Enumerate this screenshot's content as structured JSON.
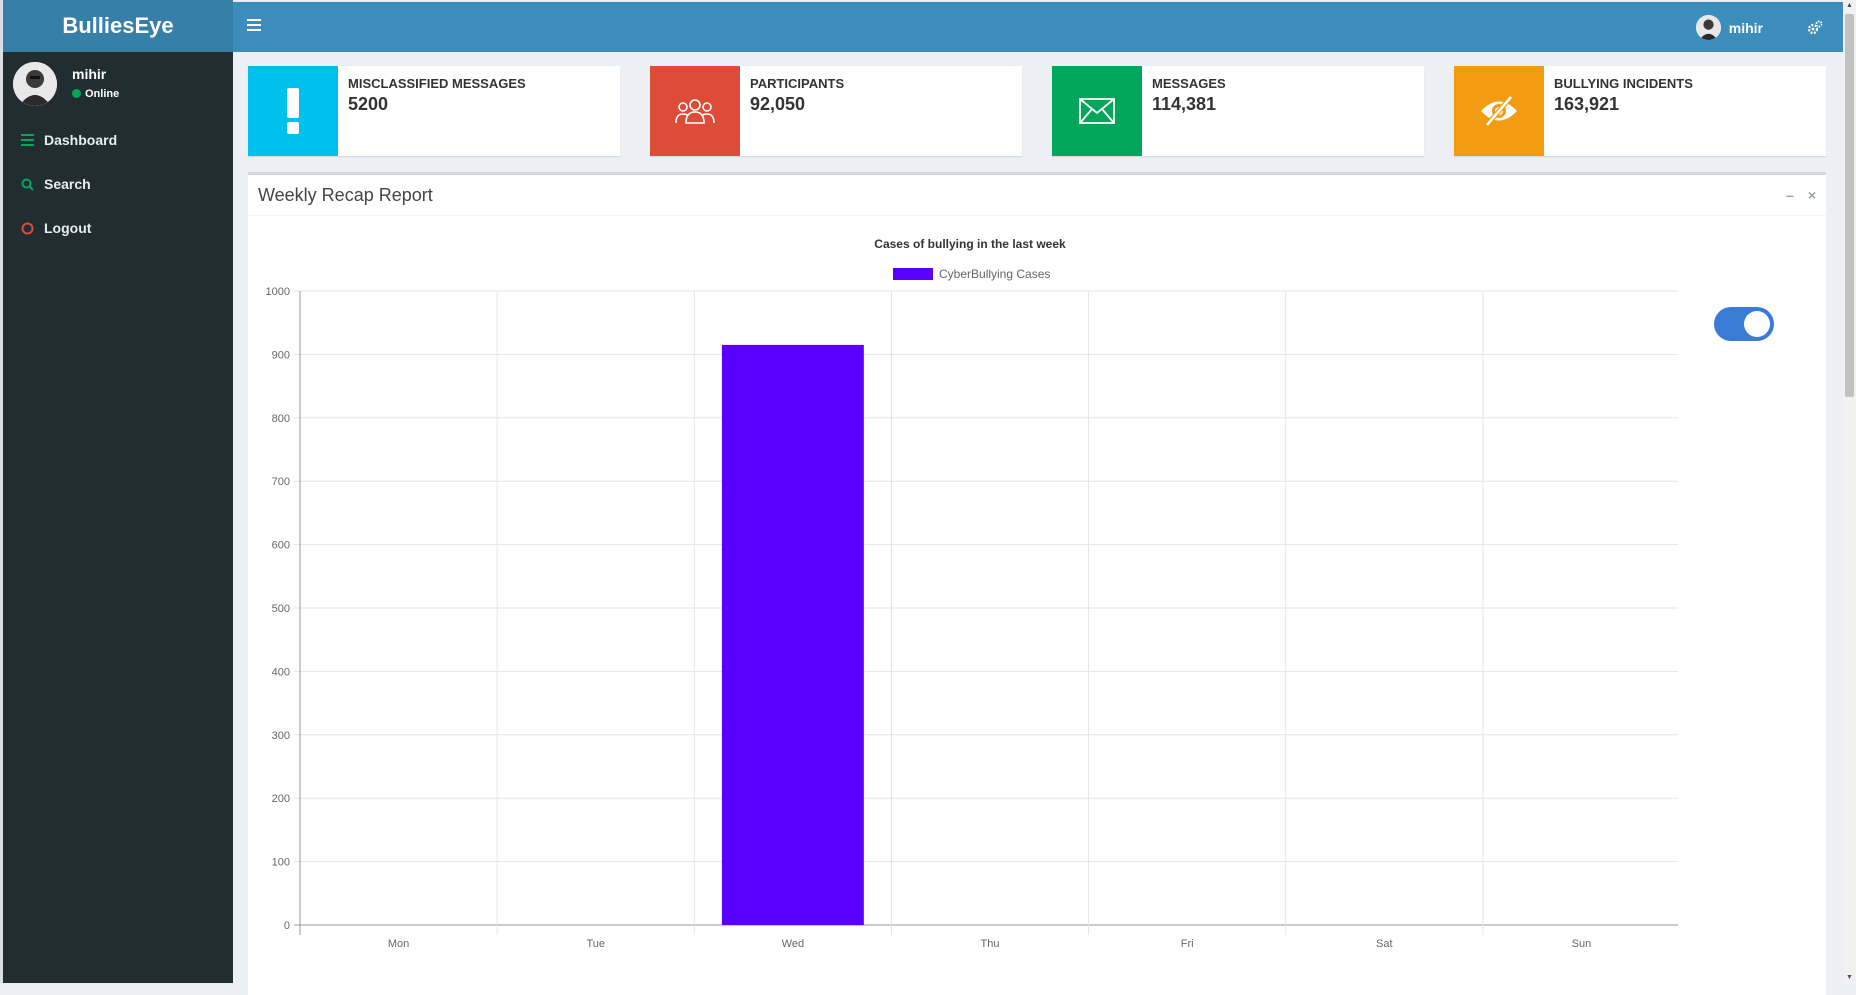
{
  "app": {
    "title": "BulliesEye"
  },
  "user": {
    "name": "mihir",
    "status": "Online"
  },
  "sidebar": {
    "items": [
      {
        "label": "Dashboard",
        "icon": "bars-icon",
        "color": "#00a65a"
      },
      {
        "label": "Search",
        "icon": "search-icon",
        "color": "#00a65a"
      },
      {
        "label": "Logout",
        "icon": "circle-icon",
        "color": "#dd4b39"
      }
    ]
  },
  "stats": [
    {
      "label": "MISCLASSIFIED MESSAGES",
      "value": "5200",
      "color": "#00c0ef",
      "icon": "exclamation-icon"
    },
    {
      "label": "PARTICIPANTS",
      "value": "92,050",
      "color": "#dd4b39",
      "icon": "users-icon"
    },
    {
      "label": "MESSAGES",
      "value": "114,381",
      "color": "#00a65a",
      "icon": "envelope-icon"
    },
    {
      "label": "BULLYING INCIDENTS",
      "value": "163,921",
      "color": "#f39c12",
      "icon": "eye-slash-icon"
    }
  ],
  "report": {
    "title": "Weekly Recap Report",
    "toggle_on": true
  },
  "colors": {
    "topbar": "#3c8dbc",
    "sidebar": "#222d32",
    "bar": "#5a00ff",
    "toggle": "#3a7bd5"
  },
  "chart_data": {
    "type": "bar",
    "title": "Cases of bullying in the last week",
    "categories": [
      "Mon",
      "Tue",
      "Wed",
      "Thu",
      "Fri",
      "Sat",
      "Sun"
    ],
    "series": [
      {
        "name": "CyberBullying Cases",
        "values": [
          0,
          0,
          915,
          0,
          0,
          0,
          0
        ],
        "color": "#5a00ff"
      }
    ],
    "yticks": [
      "0",
      "100",
      "200",
      "300",
      "400",
      "500",
      "600",
      "700",
      "800",
      "900",
      "1000"
    ],
    "ylim": [
      0,
      1000
    ],
    "grid": true,
    "legend": "top-center"
  }
}
